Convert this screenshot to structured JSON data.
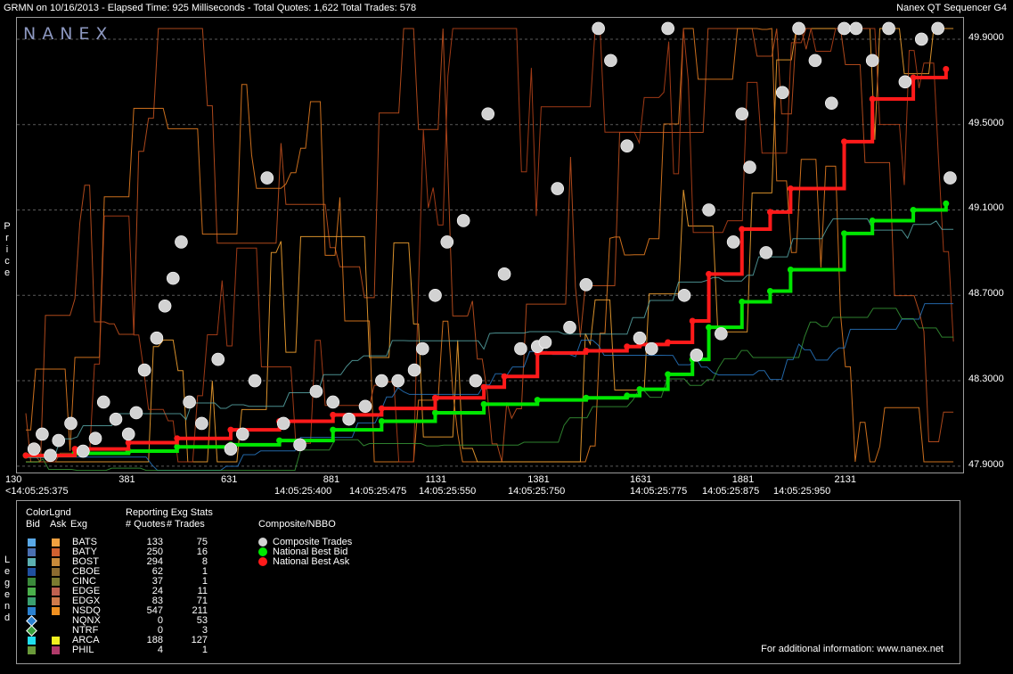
{
  "header": {
    "left": "GRMN on 10/16/2013  -  Elapsed Time: 925 Milliseconds  -  Total Quotes: 1,622  Total Trades: 578",
    "right": "Nanex QT Sequencer G4"
  },
  "logo": "NANEX",
  "side_labels": {
    "price": "Price",
    "legend": "Legend"
  },
  "chart_data": {
    "type": "scatter",
    "title": "",
    "xlabel": "",
    "ylabel": "Price",
    "x_ticks": [
      "130",
      "381",
      "631",
      "881",
      "1131",
      "1381",
      "1631",
      "1881",
      "2131"
    ],
    "x_time_labels": [
      "<14:05:25:375",
      "14:05:25:400",
      "14:05:25:475",
      "14:05:25:550",
      "14:05:25:750",
      "14:05:25:775",
      "14:05:25:875",
      "14:05:25:950"
    ],
    "y_ticks": [
      "49.9000",
      "49.5000",
      "49.1000",
      "48.7000",
      "48.3000",
      "47.9000"
    ],
    "xlim": [
      130,
      2400
    ],
    "ylim": [
      47.87,
      50.0
    ],
    "grid": true,
    "series": [
      {
        "name": "National Best Bid",
        "color": "#00e600",
        "x": [
          130,
          250,
          381,
          500,
          631,
          750,
          881,
          1000,
          1131,
          1250,
          1381,
          1500,
          1600,
          1631,
          1700,
          1760,
          1800,
          1881,
          1950,
          2000,
          2131,
          2200,
          2300,
          2380
        ],
        "y": [
          47.95,
          47.96,
          47.97,
          47.99,
          48.0,
          48.02,
          48.07,
          48.11,
          48.15,
          48.19,
          48.21,
          48.22,
          48.23,
          48.26,
          48.33,
          48.4,
          48.55,
          48.67,
          48.72,
          48.82,
          48.99,
          49.05,
          49.1,
          49.13
        ]
      },
      {
        "name": "National Best Ask",
        "color": "#ff1a1a",
        "x": [
          130,
          250,
          381,
          500,
          631,
          750,
          881,
          1000,
          1131,
          1250,
          1300,
          1381,
          1500,
          1600,
          1631,
          1700,
          1760,
          1800,
          1881,
          1950,
          2000,
          2131,
          2200,
          2300,
          2380
        ],
        "y": [
          47.95,
          47.98,
          48.01,
          48.03,
          48.07,
          48.11,
          48.14,
          48.17,
          48.22,
          48.27,
          48.32,
          48.43,
          48.44,
          48.46,
          48.47,
          48.48,
          48.58,
          48.8,
          49.01,
          49.09,
          49.2,
          49.42,
          49.62,
          49.72,
          49.76
        ]
      },
      {
        "name": "Composite Trades",
        "color": "#d2d2d2",
        "x": [
          150,
          170,
          190,
          210,
          240,
          270,
          300,
          320,
          350,
          381,
          400,
          420,
          450,
          470,
          490,
          510,
          530,
          560,
          600,
          631,
          660,
          690,
          720,
          760,
          800,
          840,
          881,
          920,
          960,
          1000,
          1040,
          1080,
          1100,
          1131,
          1160,
          1200,
          1230,
          1260,
          1300,
          1340,
          1381,
          1400,
          1430,
          1460,
          1500,
          1530,
          1560,
          1600,
          1631,
          1660,
          1700,
          1740,
          1770,
          1800,
          1830,
          1860,
          1881,
          1900,
          1940,
          1980,
          2020,
          2060,
          2100,
          2131,
          2160,
          2200,
          2240,
          2280,
          2320,
          2360,
          2390
        ],
        "y": [
          47.98,
          48.05,
          47.95,
          48.02,
          48.1,
          47.97,
          48.03,
          48.2,
          48.12,
          48.05,
          48.15,
          48.35,
          48.5,
          48.65,
          48.78,
          48.95,
          48.2,
          48.1,
          48.4,
          47.98,
          48.05,
          48.3,
          49.25,
          48.1,
          48.0,
          48.25,
          48.2,
          48.12,
          48.18,
          48.3,
          48.3,
          48.35,
          48.45,
          48.7,
          48.95,
          49.05,
          48.3,
          49.55,
          48.8,
          48.45,
          48.46,
          48.48,
          49.2,
          48.55,
          48.75,
          49.95,
          49.8,
          49.4,
          48.5,
          48.45,
          49.95,
          48.7,
          48.42,
          49.1,
          48.52,
          48.95,
          49.55,
          49.3,
          48.9,
          49.65,
          49.95,
          49.8,
          49.6,
          49.95,
          49.95,
          49.8,
          49.95,
          49.7,
          49.9,
          49.95,
          49.25
        ]
      }
    ]
  },
  "legend": {
    "col_headers": {
      "colorlgnd": "ColorLgnd",
      "bid": "Bid",
      "ask": "Ask",
      "exg": "Exg",
      "stats": "Reporting Exg Stats",
      "quotes": "# Quotes",
      "trades": "# Trades",
      "composite": "Composite/NBBO"
    },
    "exchanges": [
      {
        "name": "BATS",
        "quotes": "133",
        "trades": "75",
        "bid": "#5aa9e8",
        "ask": "#f0a040"
      },
      {
        "name": "BATY",
        "quotes": "250",
        "trades": "16",
        "bid": "#4a6fb0",
        "ask": "#d06030"
      },
      {
        "name": "BOST",
        "quotes": "294",
        "trades": "8",
        "bid": "#5cb0b0",
        "ask": "#c88a3a"
      },
      {
        "name": "CBOE",
        "quotes": "62",
        "trades": "1",
        "bid": "#2050a0",
        "ask": "#8a6a30"
      },
      {
        "name": "CINC",
        "quotes": "37",
        "trades": "1",
        "bid": "#3a8a3a",
        "ask": "#7a7a30"
      },
      {
        "name": "EDGE",
        "quotes": "24",
        "trades": "11",
        "bid": "#4ab04a",
        "ask": "#c06050"
      },
      {
        "name": "EDGX",
        "quotes": "83",
        "trades": "71",
        "bid": "#3aa070",
        "ask": "#d07a4a"
      },
      {
        "name": "NSDQ",
        "quotes": "547",
        "trades": "211",
        "bid": "#2a80d0",
        "ask": "#f09020"
      },
      {
        "name": "NQNX",
        "quotes": "0",
        "trades": "53",
        "bid": "#2a80d0",
        "ask": ""
      },
      {
        "name": "NTRF",
        "quotes": "0",
        "trades": "3",
        "bid": "#3aa03a",
        "ask": ""
      },
      {
        "name": "ARCA",
        "quotes": "188",
        "trades": "127",
        "bid": "#20e0f0",
        "ask": "#f0f020"
      },
      {
        "name": "PHIL",
        "quotes": "4",
        "trades": "1",
        "bid": "#6a9a3a",
        "ask": "#b03a6a"
      }
    ],
    "composite_items": [
      {
        "label": "Composite Trades",
        "color": "#d2d2d2"
      },
      {
        "label": "National Best Bid",
        "color": "#00e600"
      },
      {
        "label": "National Best Ask",
        "color": "#ff1a1a"
      }
    ],
    "footer": "For additional information: www.nanex.net"
  }
}
